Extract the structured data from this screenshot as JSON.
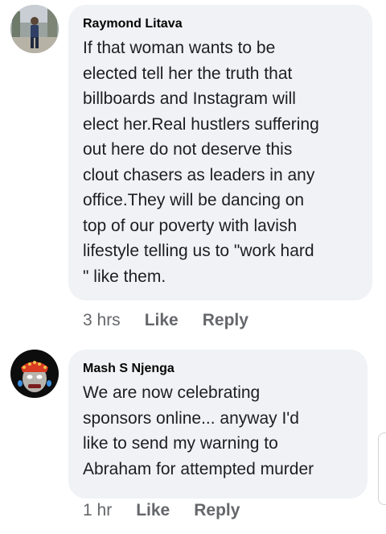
{
  "comments": [
    {
      "author": "Raymond Litava",
      "text": "If that woman wants to be\nelected tell her the truth that\nbillboards and Instagram will\nelect her.Real hustlers suffering\nout here do not deserve this\nclout chasers as leaders in any\noffice.They will be dancing on\ntop of our poverty with lavish\nlifestyle telling us to \"work  hard\n\" like them.",
      "time": "3 hrs",
      "like_label": "Like",
      "reply_label": "Reply"
    },
    {
      "author": "Mash S Njenga",
      "text": "We are now celebrating\nsponsors online... anyway I'd\nlike to send my warning to\nAbraham for attempted murder",
      "time": "1 hr",
      "like_label": "Like",
      "reply_label": "Reply"
    }
  ],
  "colors": {
    "bubble_bg": "#f0f2f5",
    "author_text": "#050505",
    "meta_text": "#65676b"
  }
}
